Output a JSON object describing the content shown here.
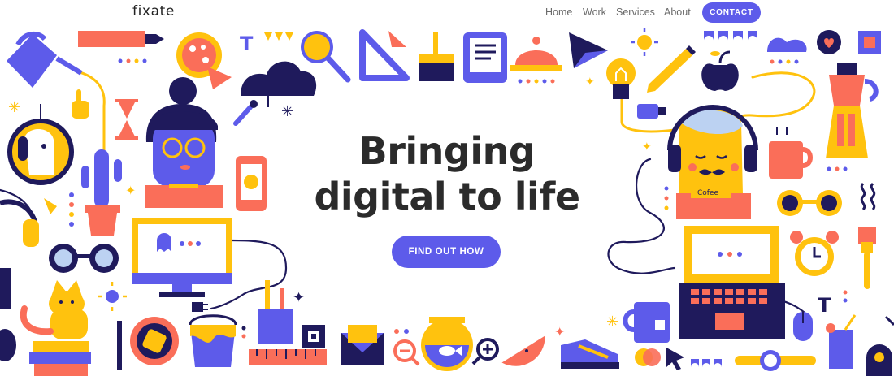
{
  "header": {
    "logo": "fixate",
    "nav": {
      "home": "Home",
      "work": "Work",
      "services": "Services",
      "about": "About"
    },
    "contact_label": "CONTACT"
  },
  "hero": {
    "title_line1": "Bringing",
    "title_line2": "digital to life",
    "cta_label": "FIND OUT HOW",
    "mug_text": "Cofee"
  },
  "colors": {
    "brand_purple": "#5d5bea",
    "navy": "#1f1a5c",
    "yellow": "#ffc20e",
    "coral": "#fa6e59",
    "pink": "#f8a6a0",
    "light_blue": "#bcd2f2"
  },
  "illustration": {
    "icons": [
      "watering-can-icon",
      "marker-icon",
      "pizza-icon",
      "cloud-icon",
      "magnifier-icon",
      "set-square-icon",
      "paint-brush-icon",
      "tablet-icon",
      "cloche-icon",
      "paper-plane-icon",
      "sun-icon",
      "cloud-icon",
      "heart-bubble-icon",
      "lightbulb-icon",
      "pencil-icon",
      "apple-icon",
      "coffee-pot-icon",
      "hourglass-icon",
      "cactus-icon",
      "phone-icon",
      "monitor-icon",
      "glasses-icon",
      "cat-icon",
      "ghost-icon",
      "laptop-icon",
      "alarm-clock-icon",
      "mug-icon",
      "envelope-icon",
      "fishbowl-icon",
      "watermelon-icon",
      "sneaker-icon",
      "ruler-icon",
      "paint-bucket-icon",
      "pen-cup-icon",
      "wristwatch-icon",
      "drink-icon",
      "headphones-icon",
      "usb-icon",
      "eyedropper-icon",
      "mouse-icon"
    ]
  }
}
